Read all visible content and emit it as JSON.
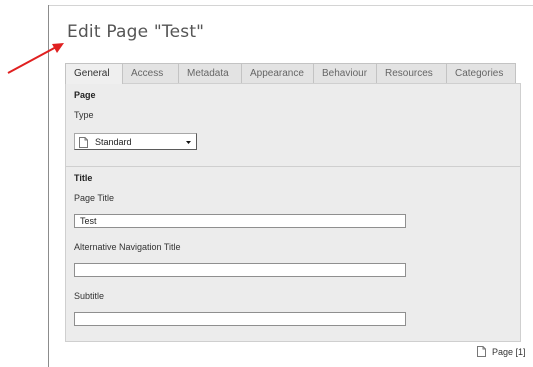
{
  "page": {
    "heading": "Edit Page \"Test\""
  },
  "tabs": [
    {
      "label": "General",
      "active": true
    },
    {
      "label": "Access"
    },
    {
      "label": "Metadata"
    },
    {
      "label": "Appearance"
    },
    {
      "label": "Behaviour"
    },
    {
      "label": "Resources"
    },
    {
      "label": "Categories"
    }
  ],
  "page_section": {
    "title": "Page",
    "type_label": "Type",
    "type_value": "Standard",
    "type_icon": "page-icon"
  },
  "title_section": {
    "title": "Title",
    "page_title_label": "Page Title",
    "page_title_value": "Test",
    "alt_nav_title_label": "Alternative Navigation Title",
    "alt_nav_title_value": "",
    "subtitle_label": "Subtitle",
    "subtitle_value": ""
  },
  "footer": {
    "page_ref": "Page [1]",
    "icon": "page-icon"
  },
  "colors": {
    "arrow": "#e02020",
    "panel": "#ececec",
    "tab": "#e3e3e3"
  }
}
